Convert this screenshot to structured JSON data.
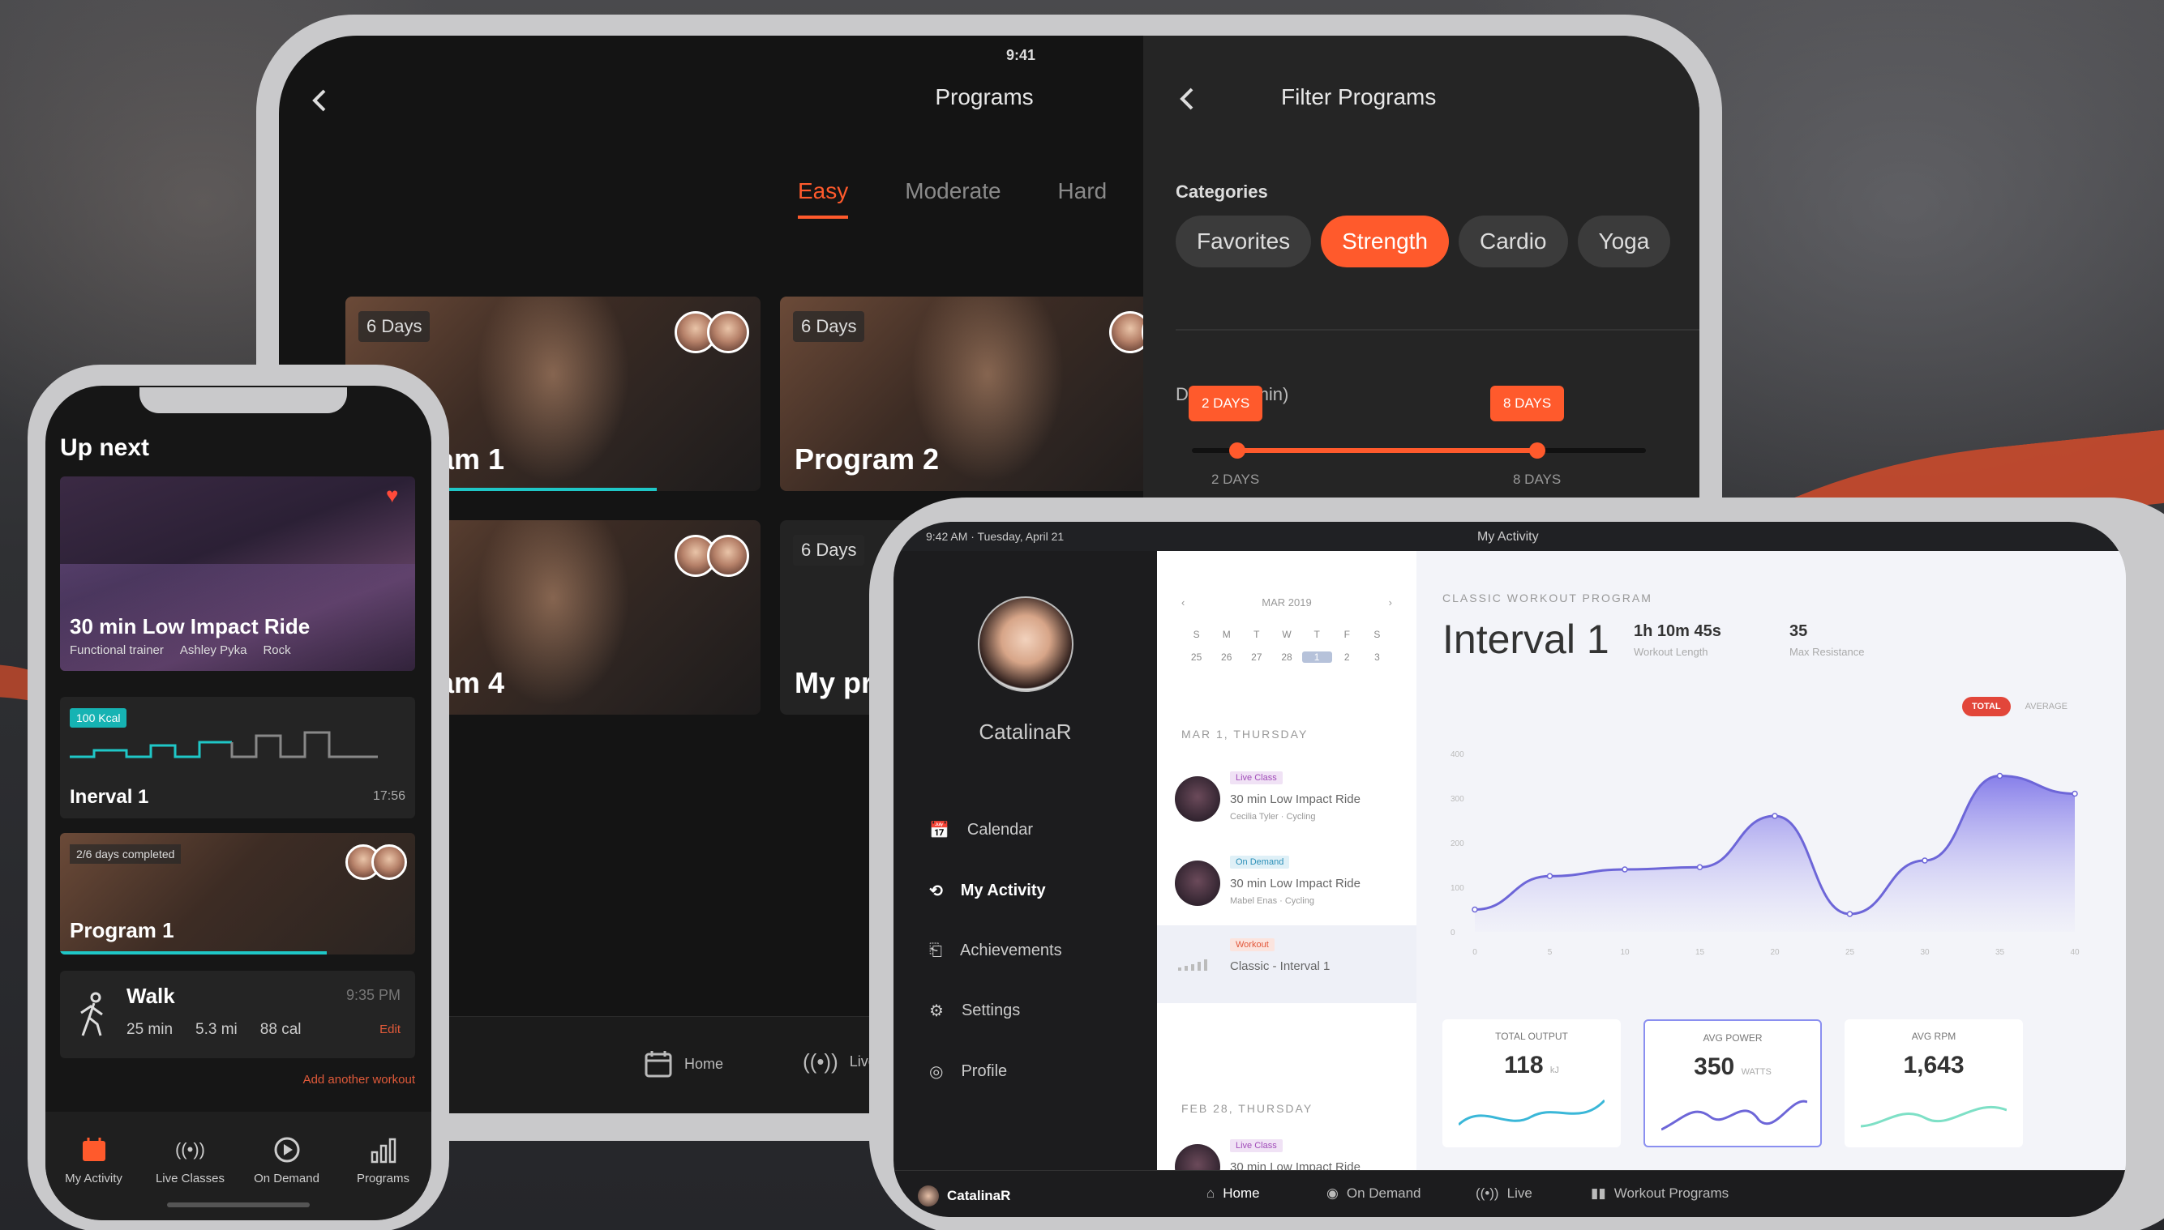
{
  "colors": {
    "accent": "#ff5a2c",
    "teal": "#1fc7c7",
    "purple": "#8a8ff0",
    "live_red": "#e2463a"
  },
  "tablet": {
    "time": "9:41",
    "title": "Programs",
    "back_icon": "chevron-left-icon",
    "tabs": [
      {
        "label": "Easy",
        "active": true
      },
      {
        "label": "Moderate",
        "active": false
      },
      {
        "label": "Hard",
        "active": false
      }
    ],
    "cards": [
      {
        "days": "6 Days",
        "title": "Program 1",
        "progress": 0.75
      },
      {
        "days": "6 Days",
        "title": "Program 2"
      },
      {
        "days": "",
        "title": "Program 4"
      },
      {
        "days": "6 Days",
        "title": "My program"
      }
    ],
    "bottom_nav": [
      {
        "label": "Home",
        "icon": "calendar-icon"
      },
      {
        "label": "Live",
        "icon": "broadcast-icon"
      }
    ],
    "filter": {
      "title": "Filter Programs",
      "categories_label": "Categories",
      "chips": [
        {
          "label": "Favorites",
          "active": false
        },
        {
          "label": "Strength",
          "active": true
        },
        {
          "label": "Cardio",
          "active": false
        },
        {
          "label": "Yoga",
          "active": false
        }
      ],
      "duration_label": "Duration (min)",
      "range_min_tip": "2 DAYS",
      "range_max_tip": "8 DAYS",
      "range_min_label": "2 DAYS",
      "range_max_label": "8 DAYS"
    }
  },
  "phone": {
    "up_next": "Up next",
    "hero": {
      "title": "30 min Low Impact Ride",
      "tags": [
        "Functional trainer",
        "Ashley Pyka",
        "Rock"
      ]
    },
    "interval": {
      "kcal": "100 Kcal",
      "name": "Inerval 1",
      "duration": "17:56"
    },
    "program": {
      "completed": "2/6 days completed",
      "title": "Program 1",
      "progress": 0.75
    },
    "walk": {
      "name": "Walk",
      "time": "9:35 PM",
      "duration": "25 min",
      "distance": "5.3 mi",
      "calories": "88 cal",
      "edit": "Edit"
    },
    "add_workout": "Add another workout",
    "nav": [
      {
        "label": "My Activity",
        "icon": "calendar-icon"
      },
      {
        "label": "Live Classes",
        "icon": "broadcast-icon"
      },
      {
        "label": "On Demand",
        "icon": "play-circle-icon"
      },
      {
        "label": "Programs",
        "icon": "bar-chart-icon"
      }
    ]
  },
  "laptop": {
    "status_left": "9:42 AM · Tuesday, April 21",
    "status_center": "My Activity",
    "user": "CatalinaR",
    "menu": [
      {
        "label": "Calendar",
        "icon": "calendar-icon",
        "active": false
      },
      {
        "label": "My Activity",
        "icon": "history-icon",
        "active": true
      },
      {
        "label": "Achievements",
        "icon": "bookmark-icon",
        "active": false
      },
      {
        "label": "Settings",
        "icon": "gear-icon",
        "active": false
      },
      {
        "label": "Profile",
        "icon": "user-circle-icon",
        "active": false
      }
    ],
    "calendar": {
      "month": "MAR 2019",
      "weekdays": [
        "S",
        "M",
        "T",
        "W",
        "T",
        "F",
        "S"
      ],
      "days": [
        "25",
        "26",
        "27",
        "28",
        "1",
        "2",
        "3"
      ],
      "selected_index": 4
    },
    "day_groups": [
      {
        "label": "MAR 1, THURSDAY",
        "entries": [
          {
            "tag": "Live Class",
            "title": "30 min Low Impact Ride",
            "meta": "Cecilia Tyler · Cycling"
          },
          {
            "tag": "On Demand",
            "title": "30 min Low Impact Ride",
            "meta": "Mabel Enas · Cycling"
          },
          {
            "tag": "Workout",
            "title": "Classic - Interval 1",
            "meta": ""
          }
        ]
      },
      {
        "label": "FEB 28, THURSDAY",
        "entries": [
          {
            "tag": "Live Class",
            "title": "30 min Low Impact Ride",
            "meta": ""
          }
        ]
      }
    ],
    "main": {
      "caption": "CLASSIC WORKOUT PROGRAM",
      "title": "Interval 1",
      "stat1_value": "1h 10m 45s",
      "stat1_label": "Workout Length",
      "stat2_value": "35",
      "stat2_label": "Max Resistance",
      "toggle_on": "TOTAL",
      "toggle_off": "AVERAGE"
    },
    "tiles": [
      {
        "label": "TOTAL OUTPUT",
        "value": "118",
        "unit": "kJ",
        "selected": false
      },
      {
        "label": "AVG POWER",
        "value": "350",
        "unit": "WATTS",
        "selected": true
      },
      {
        "label": "AVG RPM",
        "value": "1,643",
        "unit": "",
        "selected": false
      }
    ],
    "bottom_nav": [
      {
        "label": "Home",
        "icon": "home-icon"
      },
      {
        "label": "On Demand",
        "icon": "play-circle-icon"
      },
      {
        "label": "Live",
        "icon": "broadcast-icon"
      },
      {
        "label": "Workout Programs",
        "icon": "bar-chart-icon"
      }
    ]
  },
  "chart_data": {
    "type": "area",
    "x": [
      0,
      5,
      10,
      15,
      20,
      25,
      30,
      35,
      40
    ],
    "y_ticks": [
      0,
      100,
      200,
      300,
      400
    ],
    "series": [
      {
        "values": [
          50,
          125,
          140,
          145,
          260,
          40,
          160,
          350,
          310
        ]
      }
    ],
    "ylim": [
      0,
      400
    ]
  }
}
